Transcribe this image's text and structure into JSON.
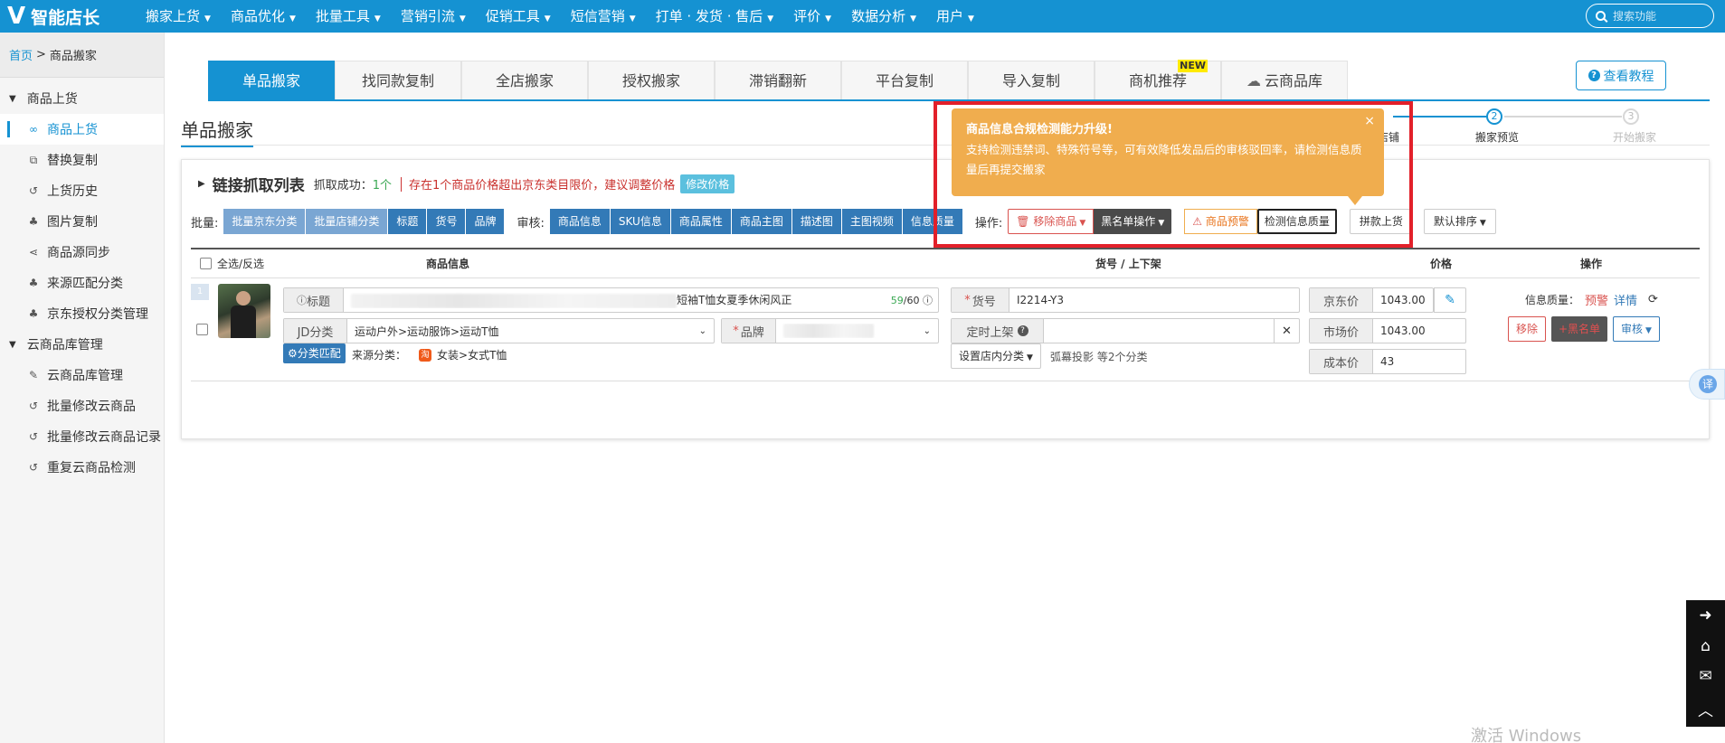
{
  "app": {
    "logo_mark": "V",
    "name": "智能店长"
  },
  "nav": {
    "items": [
      "搬家上货",
      "商品优化",
      "批量工具",
      "营销引流",
      "促销工具",
      "短信营销",
      "打单 · 发货 · 售后",
      "评价",
      "数据分析",
      "用户"
    ],
    "search_placeholder": "搜索功能"
  },
  "breadcrumb": {
    "home": "首页",
    "sep": ">",
    "current": "商品搬家"
  },
  "sidebar": {
    "groups": [
      {
        "label": "商品上货",
        "items": [
          "商品上货",
          "替换复制",
          "上货历史",
          "图片复制",
          "商品源同步",
          "来源匹配分类",
          "京东授权分类管理"
        ]
      },
      {
        "label": "云商品库管理",
        "items": [
          "云商品库管理",
          "批量修改云商品",
          "批量修改云商品记录",
          "重复云商品检测"
        ]
      }
    ]
  },
  "tabs": [
    "单品搬家",
    "找同款复制",
    "全店搬家",
    "授权搬家",
    "滞销翻新",
    "平台复制",
    "导入复制",
    "商机推荐",
    "云商品库"
  ],
  "tabs_new_badge": "NEW",
  "tutorial_button": "查看教程",
  "page_title": "单品搬家",
  "steps": [
    {
      "num": "",
      "label": "店铺"
    },
    {
      "num": "2",
      "label": "搬家预览"
    },
    {
      "num": "3",
      "label": "开始搬家"
    }
  ],
  "list": {
    "title": "链接抓取列表",
    "count_label": "抓取成功：",
    "count_value": "1个",
    "warning": "存在1个商品价格超出京东类目限价，建议调整价格",
    "edit_price": "修改价格"
  },
  "toolbar": {
    "batch_label": "批量:",
    "batch_buttons": [
      "批量京东分类",
      "批量店铺分类",
      "标题",
      "货号",
      "品牌"
    ],
    "audit_label": "审核:",
    "audit_buttons": [
      "商品信息",
      "SKU信息",
      "商品属性",
      "商品主图",
      "描述图",
      "主图视频",
      "信息质量"
    ],
    "op_label": "操作:",
    "remove_goods": "移除商品",
    "blacklist_ops": "黑名单操作",
    "goods_warning": "商品预警",
    "check_quality": "检测信息质量",
    "pin_upload": "拼款上货",
    "default_sort": "默认排序"
  },
  "popover": {
    "title": "商品信息合规检测能力升级!",
    "body": "支持检测违禁词、特殊符号等，可有效降低发品后的审核驳回率，请检测信息质量后再提交搬家",
    "close": "×"
  },
  "table": {
    "headers": {
      "select_all": "全选/反选",
      "info": "商品信息",
      "sku": "货号 / 上下架",
      "price": "价格",
      "ops": "操作"
    },
    "rows": [
      {
        "num": "1",
        "title_label": "标题",
        "title_suffix": "短袖T恤女夏季休闲风正",
        "title_count": "59",
        "title_max": "/60",
        "jd_cat_label": "JD分类",
        "jd_cat_value": "运动户外>运动服饰>运动T恤",
        "brand_label": "品牌",
        "cat_match": "分类匹配",
        "src_cat_label": "来源分类：",
        "src_cat_value": "女装>女式T恤",
        "sku_label": "货号",
        "sku_value": "I2214-Y3",
        "timed_label": "定时上架",
        "store_cat_button": "设置店内分类",
        "store_cat_note": "弧幕投影 等2个分类",
        "jd_price_label": "京东价",
        "jd_price": "1043.00",
        "market_price_label": "市场价",
        "market_price": "1043.00",
        "cost_price_label": "成本价",
        "cost_price": "43",
        "quality_label": "信息质量：",
        "quality_warn": "预警",
        "quality_detail": "详情",
        "remove": "移除",
        "blacklist": "+黑名单",
        "audit": "审核"
      }
    ]
  },
  "float": {
    "translate": "译"
  },
  "watermark": "激活 Windows"
}
